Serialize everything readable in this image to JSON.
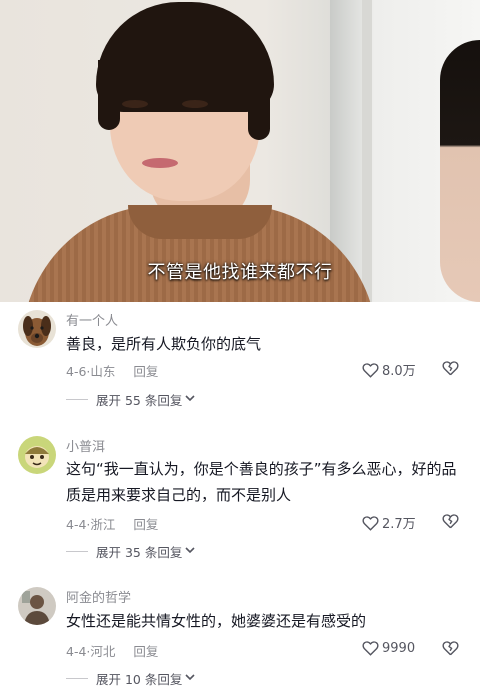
{
  "video": {
    "subtitle": "不管是他找谁来都不行"
  },
  "comments": [
    {
      "username": "有一个人",
      "avatar_icon": "dog-avatar",
      "text": "善良，是所有人欺负你的底气",
      "date": "4-6",
      "location": "山东",
      "reply_label": "回复",
      "likes": "8.0万",
      "expand_label": "展开 55 条回复"
    },
    {
      "username": "小普洱",
      "avatar_icon": "cartoon-avatar",
      "text": "这句“我一直认为，你是个善良的孩子”有多么恶心，好的品质是用来要求自己的，而不是别人",
      "date": "4-4",
      "location": "浙江",
      "reply_label": "回复",
      "likes": "2.7万",
      "expand_label": "展开 35 条回复"
    },
    {
      "username": "阿金的哲学",
      "avatar_icon": "person-avatar",
      "text": "女性还是能共情女性的，她婆婆还是有感受的",
      "date": "4-4",
      "location": "河北",
      "reply_label": "回复",
      "likes": "9990",
      "expand_label": "展开 10 条回复"
    }
  ],
  "colors": {
    "text_primary": "#161823",
    "text_secondary": "#8a8b91"
  }
}
